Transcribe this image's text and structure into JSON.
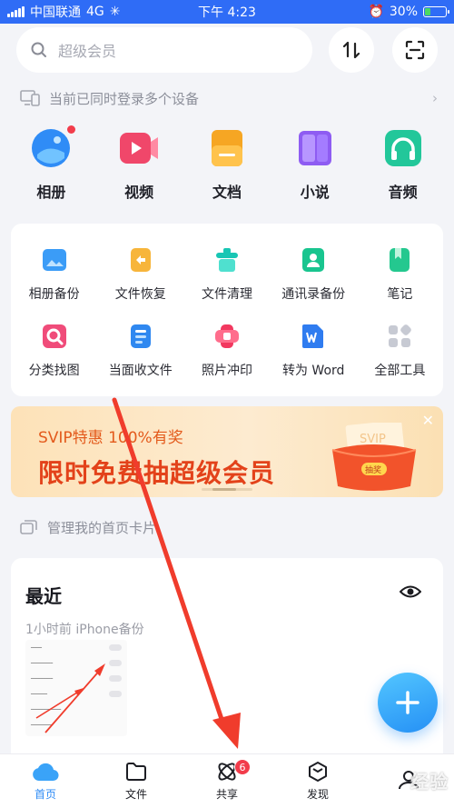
{
  "status_bar": {
    "carrier": "中国联通",
    "network": "4G",
    "time": "下午 4:23",
    "battery": "30%",
    "battery_level": 0.3
  },
  "search": {
    "placeholder": "超级会员"
  },
  "notice": {
    "text": "当前已同时登录多个设备"
  },
  "categories": [
    {
      "label": "相册",
      "icon": "album-icon",
      "color": "#2f8cf6"
    },
    {
      "label": "视频",
      "icon": "video-icon",
      "color": "#f0476a"
    },
    {
      "label": "文档",
      "icon": "document-icon",
      "color": "#f6a623"
    },
    {
      "label": "小说",
      "icon": "novel-icon",
      "color": "#8e5cf2"
    },
    {
      "label": "音频",
      "icon": "audio-icon",
      "color": "#22c79a"
    }
  ],
  "tools": [
    {
      "label": "相册备份",
      "icon": "photo-backup-icon"
    },
    {
      "label": "文件恢复",
      "icon": "file-restore-icon"
    },
    {
      "label": "文件清理",
      "icon": "file-cleanup-icon"
    },
    {
      "label": "通讯录备份",
      "icon": "contacts-backup-icon"
    },
    {
      "label": "笔记",
      "icon": "notes-icon"
    },
    {
      "label": "分类找图",
      "icon": "image-search-icon"
    },
    {
      "label": "当面收文件",
      "icon": "receive-file-icon"
    },
    {
      "label": "照片冲印",
      "icon": "photo-print-icon"
    },
    {
      "label": "转为 Word",
      "icon": "convert-word-icon"
    },
    {
      "label": "全部工具",
      "icon": "all-tools-icon"
    }
  ],
  "banner": {
    "subtitle": "SVIP特惠 100%有奖",
    "title": "限时免费抽超级会员",
    "card_text": "SVIP",
    "badge": "抽奖"
  },
  "manage": {
    "text": "管理我的首页卡片"
  },
  "recent": {
    "title": "最近",
    "meta": "1小时前 iPhone备份"
  },
  "tabs": [
    {
      "label": "首页",
      "icon": "home-cloud-icon",
      "active": true
    },
    {
      "label": "文件",
      "icon": "folder-icon"
    },
    {
      "label": "共享",
      "icon": "share-icon",
      "badge": "6"
    },
    {
      "label": "发现",
      "icon": "discover-icon"
    },
    {
      "label": "",
      "icon": "profile-icon"
    }
  ],
  "watermark": "经验"
}
